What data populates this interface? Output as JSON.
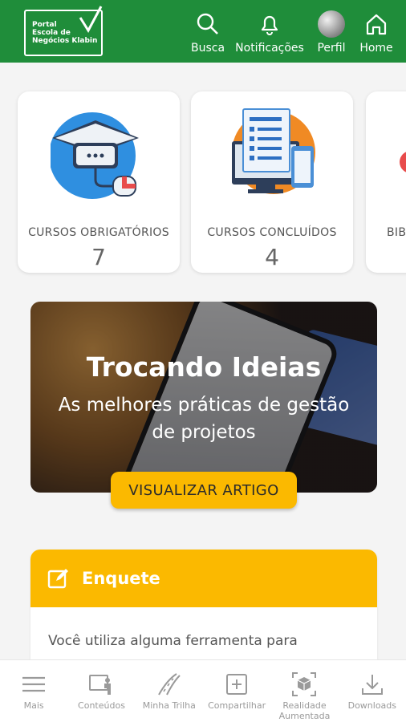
{
  "header": {
    "logo_lines": [
      "Portal",
      "Escola de",
      "Negócios Klabin"
    ],
    "nav": [
      {
        "label": "Busca",
        "icon": "search-icon"
      },
      {
        "label": "Notificações",
        "icon": "bell-icon"
      },
      {
        "label": "Perfil",
        "icon": "avatar"
      },
      {
        "label": "Home",
        "icon": "home-icon"
      }
    ]
  },
  "cards": [
    {
      "label": "CURSOS OBRIGATÓRIOS",
      "count": "7"
    },
    {
      "label": "CURSOS CONCLUÍDOS",
      "count": "4"
    },
    {
      "label": "BIBL",
      "count": ""
    }
  ],
  "banner": {
    "title": "Trocando Ideias",
    "subtitle": "As melhores práticas de gestão de projetos",
    "cta": "VISUALIZAR ARTIGO"
  },
  "poll": {
    "title": "Enquete",
    "question": "Você utiliza alguma ferramenta para"
  },
  "tabbar": [
    {
      "label": "Mais",
      "icon": "menu-icon"
    },
    {
      "label": "Conteúdos",
      "icon": "contents-icon"
    },
    {
      "label": "Minha Trilha",
      "icon": "road-icon"
    },
    {
      "label": "Compartilhar",
      "icon": "share-plus-icon"
    },
    {
      "label": "Realidade Aumentada",
      "icon": "ar-cube-icon"
    },
    {
      "label": "Downloads",
      "icon": "download-icon"
    }
  ],
  "colors": {
    "brand_green": "#1f8d3a",
    "accent_yellow": "#fbb900"
  }
}
